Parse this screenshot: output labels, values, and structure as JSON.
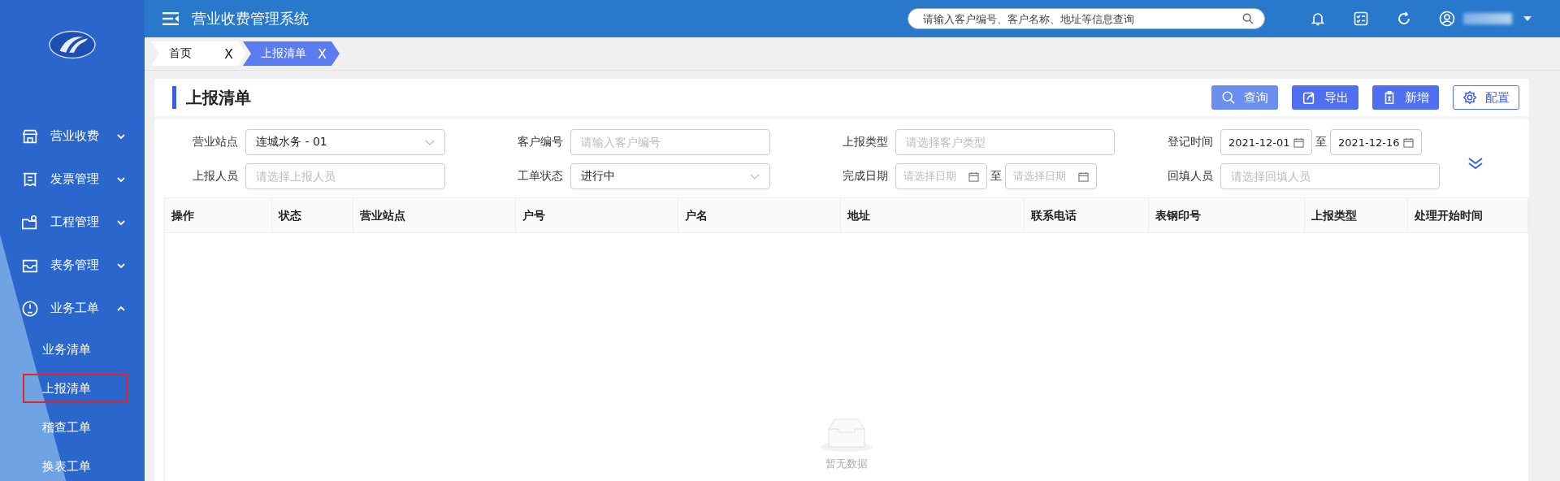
{
  "app": {
    "title": "营业收费管理系统",
    "search": {
      "placeholder": "请输入客户编号、客户名称、地址等信息查询"
    }
  },
  "sidebar": {
    "items": [
      {
        "label": "营业收费",
        "expanded": false
      },
      {
        "label": "发票管理",
        "expanded": false
      },
      {
        "label": "工程管理",
        "expanded": false
      },
      {
        "label": "表务管理",
        "expanded": false
      },
      {
        "label": "业务工单",
        "expanded": true,
        "children": [
          {
            "label": "业务清单",
            "selected": false
          },
          {
            "label": "上报清单",
            "selected": true
          },
          {
            "label": "稽查工单",
            "selected": false
          },
          {
            "label": "换表工单",
            "selected": false
          }
        ]
      }
    ]
  },
  "tabs": [
    {
      "label": "首页",
      "close": "X",
      "selected": false
    },
    {
      "label": "上报清单",
      "close": "X",
      "selected": true
    }
  ],
  "page": {
    "title": "上报清单",
    "buttons": [
      {
        "label": "查询"
      },
      {
        "label": "导出"
      },
      {
        "label": "新增"
      },
      {
        "label": "配置"
      }
    ]
  },
  "filters": [
    {
      "label": "营业站点",
      "kind": "select",
      "value": "连城水务 - 01"
    },
    {
      "label": "客户编号",
      "kind": "input",
      "placeholder": "请输入客户编号"
    },
    {
      "label": "上报类型",
      "kind": "input",
      "placeholder": "请选择客户类型"
    },
    {
      "label": "登记时间",
      "kind": "date_range",
      "from": {
        "value": "2021-12-01"
      },
      "separator": "至",
      "to": {
        "value": "2021-12-16"
      }
    },
    {
      "label": "上报人员",
      "kind": "input",
      "placeholder": "请选择上报人员"
    },
    {
      "label": "工单状态",
      "kind": "select",
      "value": "进行中"
    },
    {
      "label": "完成日期",
      "kind": "date_range",
      "from": {
        "placeholder": "请选择日期"
      },
      "separator": "至",
      "to": {
        "placeholder": "请选择日期"
      }
    },
    {
      "label": "回填人员",
      "kind": "input",
      "placeholder": "请选择回填人员"
    }
  ],
  "table": {
    "columns": [
      "操作",
      "状态",
      "营业站点",
      "户号",
      "户名",
      "地址",
      "联系电话",
      "表钢印号",
      "上报类型",
      "处理开始时间"
    ],
    "empty_text": "暂无数据"
  }
}
